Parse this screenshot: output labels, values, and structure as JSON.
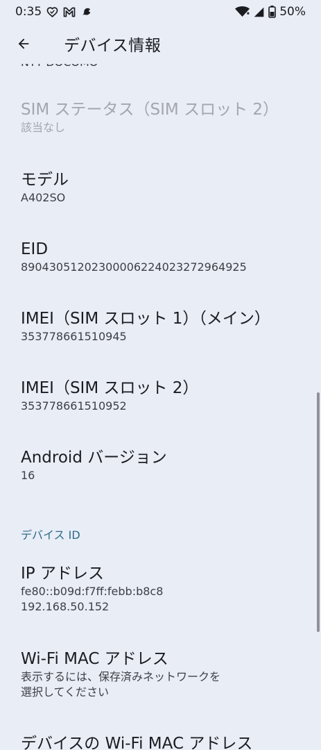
{
  "status_bar": {
    "time": "0:35",
    "battery": "50%",
    "icons": [
      "heart-outline-icon",
      "gmail-icon",
      "app-notification-icon",
      "wifi-icon",
      "signal-icon",
      "battery-icon"
    ]
  },
  "header": {
    "title": "デバイス情報",
    "back_icon": "arrow-left-icon"
  },
  "list": {
    "clipped_top_value": "NTT DOCOMO",
    "items": [
      {
        "title": "SIM ステータス（SIM スロット 2）",
        "summary": "該当なし",
        "disabled": true
      },
      {
        "title": "モデル",
        "summary": "A402SO"
      },
      {
        "title": "EID",
        "summary": "89043051202300006224023272964925"
      },
      {
        "title": "IMEI（SIM スロット 1）（メイン）",
        "summary": "353778661510945"
      },
      {
        "title": "IMEI（SIM スロット 2）",
        "summary": "353778661510952"
      },
      {
        "title": "Android バージョン",
        "summary": "16"
      }
    ],
    "section_device_id": "デバイス ID",
    "ip": {
      "title": "IP アドレス",
      "line1": "fe80::b09d:f7ff:febb:b8c8",
      "line2": "192.168.50.152"
    },
    "wifi_mac": {
      "title": "Wi-Fi MAC アドレス",
      "line1": "表示するには、保存済みネットワークを",
      "line2": "選択してください"
    },
    "device_wifi_mac_title": "デバイスの Wi-Fi MAC アドレス"
  },
  "colors": {
    "background": "#e8edf6",
    "text_primary": "#1b1c20",
    "text_secondary": "#3d3f45",
    "disabled": "#a3a6ad",
    "accent": "#2d6b8a"
  }
}
